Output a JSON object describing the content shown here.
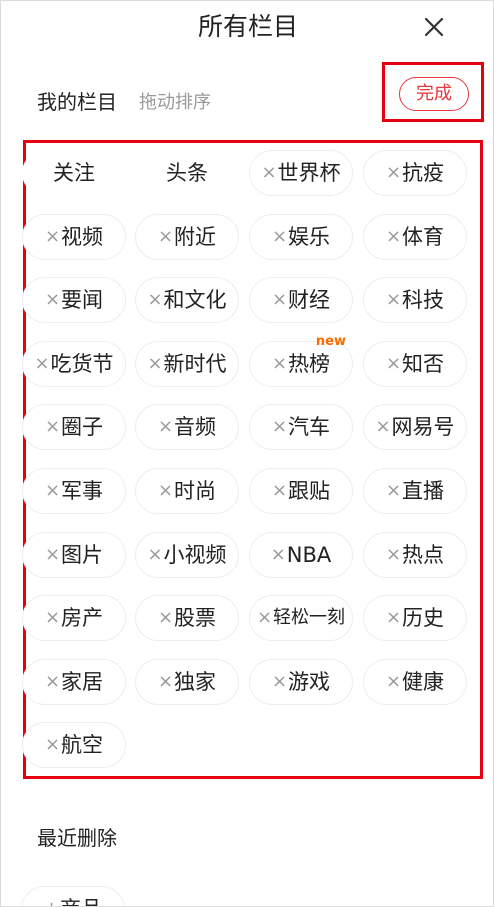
{
  "header": {
    "title": "所有栏目"
  },
  "my_columns": {
    "title": "我的栏目",
    "hint": "拖动排序",
    "done_label": "完成",
    "items": [
      {
        "label": "关注",
        "removable": false
      },
      {
        "label": "头条",
        "removable": false
      },
      {
        "label": "世界杯",
        "removable": true
      },
      {
        "label": "抗疫",
        "removable": true
      },
      {
        "label": "视频",
        "removable": true
      },
      {
        "label": "附近",
        "removable": true
      },
      {
        "label": "娱乐",
        "removable": true
      },
      {
        "label": "体育",
        "removable": true
      },
      {
        "label": "要闻",
        "removable": true
      },
      {
        "label": "和文化",
        "removable": true
      },
      {
        "label": "财经",
        "removable": true
      },
      {
        "label": "科技",
        "removable": true
      },
      {
        "label": "吃货节",
        "removable": true
      },
      {
        "label": "新时代",
        "removable": true
      },
      {
        "label": "热榜",
        "removable": true,
        "badge": "new"
      },
      {
        "label": "知否",
        "removable": true
      },
      {
        "label": "圈子",
        "removable": true
      },
      {
        "label": "音频",
        "removable": true
      },
      {
        "label": "汽车",
        "removable": true
      },
      {
        "label": "网易号",
        "removable": true
      },
      {
        "label": "军事",
        "removable": true
      },
      {
        "label": "时尚",
        "removable": true
      },
      {
        "label": "跟贴",
        "removable": true
      },
      {
        "label": "直播",
        "removable": true
      },
      {
        "label": "图片",
        "removable": true
      },
      {
        "label": "小视频",
        "removable": true
      },
      {
        "label": "NBA",
        "removable": true
      },
      {
        "label": "热点",
        "removable": true
      },
      {
        "label": "房产",
        "removable": true
      },
      {
        "label": "股票",
        "removable": true
      },
      {
        "label": "轻松一刻",
        "removable": true
      },
      {
        "label": "历史",
        "removable": true
      },
      {
        "label": "家居",
        "removable": true
      },
      {
        "label": "独家",
        "removable": true
      },
      {
        "label": "游戏",
        "removable": true
      },
      {
        "label": "健康",
        "removable": true
      },
      {
        "label": "航空",
        "removable": true
      }
    ]
  },
  "recent_deleted": {
    "title": "最近删除",
    "items": [
      {
        "label": "商品"
      }
    ]
  },
  "icons": {
    "close": "close-icon",
    "remove": "remove-x-icon"
  },
  "colors": {
    "accent_red": "#e4393c",
    "badge_orange": "#ff6a00",
    "chip_border": "#eeeeee",
    "muted_text": "#999999"
  }
}
